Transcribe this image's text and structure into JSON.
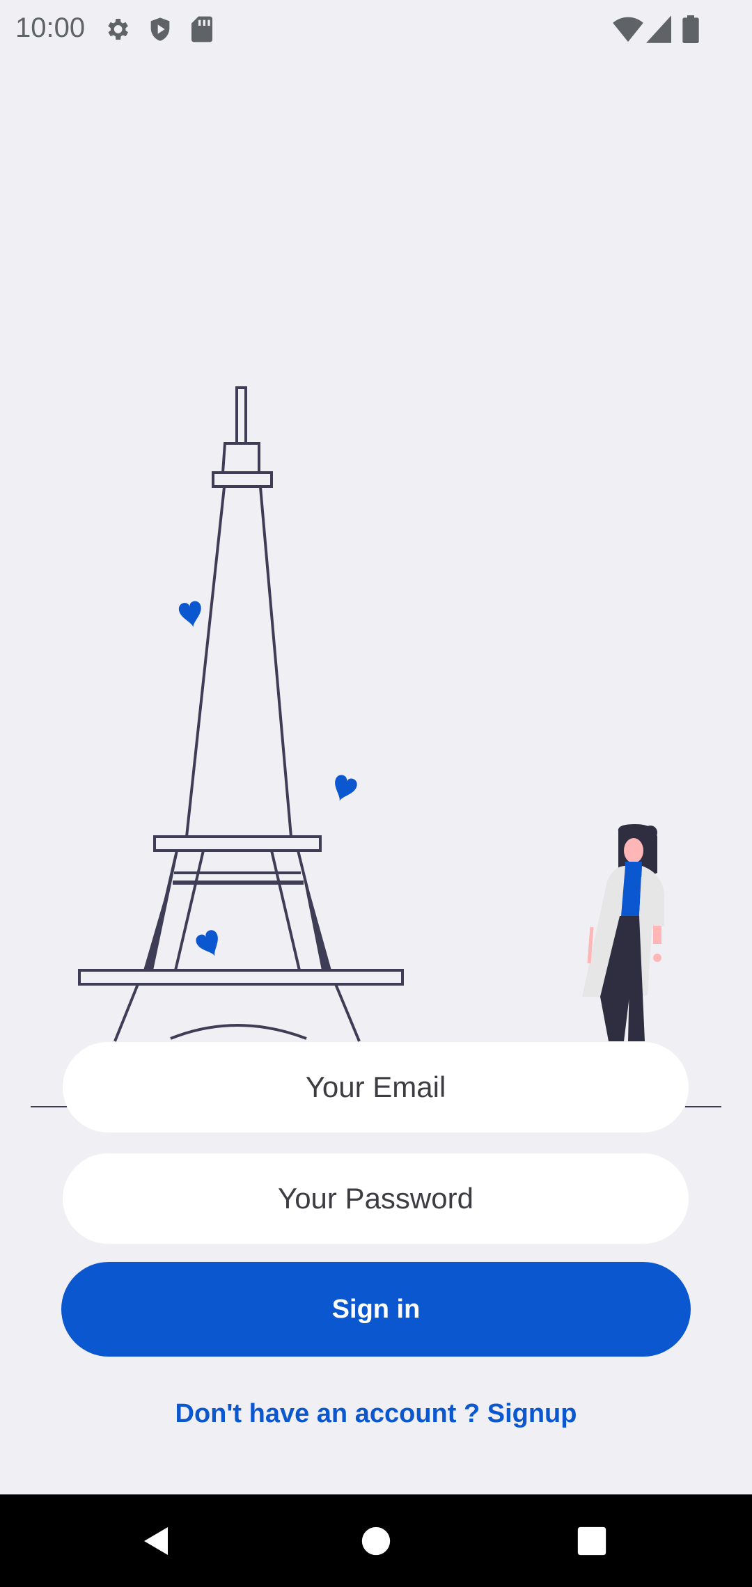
{
  "status_bar": {
    "time": "10:00",
    "left_icons": [
      "gear-icon",
      "shield-icon",
      "sd-card-icon"
    ],
    "right_icons": [
      "wifi-icon",
      "cell-signal-icon",
      "battery-icon"
    ]
  },
  "login": {
    "email_placeholder": "Your Email",
    "password_placeholder": "Your Password",
    "signin_label": "Sign in",
    "signup_text": "Don't have an account ? Signup"
  },
  "nav_bar": {
    "buttons": [
      "back-icon",
      "home-icon",
      "recents-icon"
    ]
  },
  "colors": {
    "background": "#f0eff3",
    "accent": "#0b57d0",
    "tower_stroke": "#3f3d56",
    "heart": "#0b57d0"
  }
}
